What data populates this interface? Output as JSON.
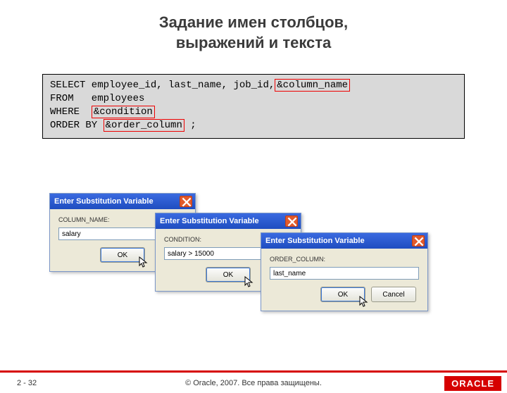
{
  "title": {
    "line1": "Задание имен столбцов,",
    "line2": "выражений и текста"
  },
  "sql": {
    "line1_a": "SELECT employee_id, last_name, job_id,",
    "line1_var": "&column_name",
    "line2": "FROM   employees",
    "line3_a": "WHERE  ",
    "line3_var": "&condition",
    "line4_a": "ORDER BY ",
    "line4_var": "&order_column",
    "line4_b": " ;"
  },
  "dialog": {
    "title": "Enter Substitution Variable",
    "ok": "OK",
    "cancel": "Cancel",
    "d1": {
      "label": "COLUMN_NAME:",
      "value": "salary"
    },
    "d2": {
      "label": "CONDITION:",
      "value": "salary > 15000"
    },
    "d3": {
      "label": "ORDER_COLUMN:",
      "value": "last_name"
    }
  },
  "footer": {
    "page": "2 - 32",
    "copyright": "© Oracle, 2007. Все права защищены.",
    "logo": "ORACLE"
  }
}
